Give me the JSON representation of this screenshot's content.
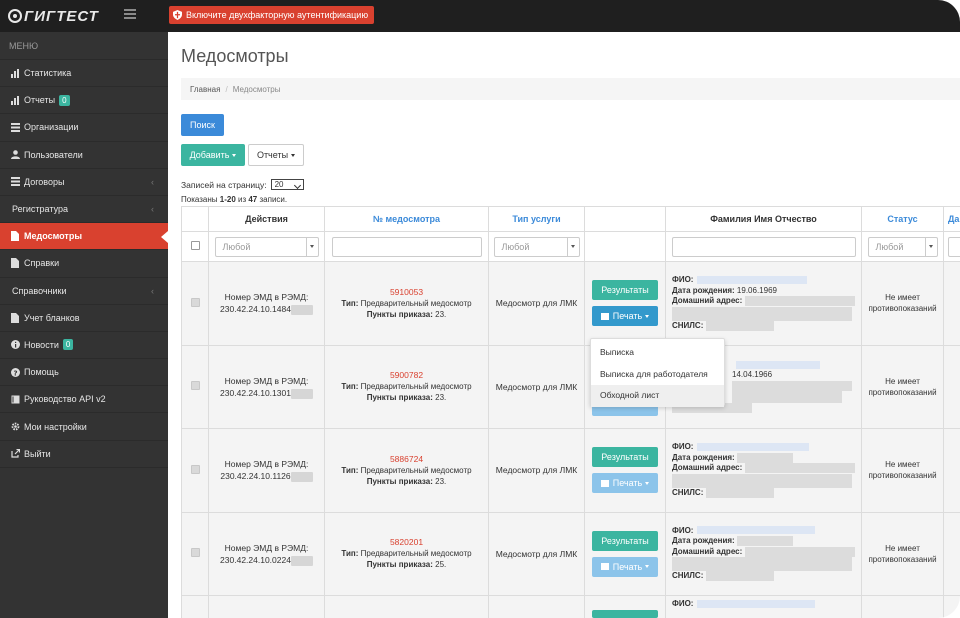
{
  "app": {
    "logo_text": "ГИГТЕСТ",
    "alert_2fa": "Включите двухфакторную аутентификацию"
  },
  "colors": {
    "sidebar_bg": "#333333",
    "topbar_bg": "#1f1f1f",
    "accent_red": "#d9412f",
    "teal": "#3bb5a0",
    "blue": "#3b8ad9"
  },
  "sidebar": {
    "header": "МЕНЮ",
    "items": [
      {
        "label": "Статистика",
        "icon": "bar-chart-icon"
      },
      {
        "label": "Отчеты",
        "icon": "bar-chart-icon",
        "badge": "0"
      },
      {
        "label": "Организации",
        "icon": "list-icon"
      },
      {
        "label": "Пользователи",
        "icon": "user-icon"
      },
      {
        "label": "Договоры",
        "icon": "list-icon",
        "chevron": "‹"
      },
      {
        "label": "Регистратура",
        "chevron": "‹"
      },
      {
        "label": "Медосмотры",
        "icon": "file-icon",
        "active": true
      },
      {
        "label": "Справки",
        "icon": "file-icon"
      },
      {
        "label": "Справочники",
        "chevron": "‹"
      },
      {
        "label": "Учет бланков",
        "icon": "file-icon"
      },
      {
        "label": "Новости",
        "icon": "info-icon",
        "badge": "0"
      },
      {
        "label": "Помощь",
        "icon": "question-icon"
      },
      {
        "label": "Руководство API v2",
        "icon": "book-icon"
      },
      {
        "label": "Мои настройки",
        "icon": "gear-icon"
      },
      {
        "label": "Выйти",
        "icon": "logout-icon"
      }
    ]
  },
  "page": {
    "title": "Медосмотры",
    "breadcrumb": {
      "home": "Главная",
      "sep": "/",
      "current": "Медосмотры"
    },
    "search_button": "Поиск",
    "add_button": "Добавить",
    "reports_button": "Отчеты",
    "per_page_label": "Записей на страницу:",
    "per_page_value": "20",
    "shown_prefix": "Показаны ",
    "shown_range": "1-20",
    "shown_mid": " из ",
    "shown_total": "47",
    "shown_suffix": " записи."
  },
  "table": {
    "headers": {
      "actions": "Действия",
      "number": "№ медосмотра",
      "service_type": "Тип услуги",
      "fio": "Фамилия Имя Отчество",
      "status": "Статус",
      "date_partial": "Да"
    },
    "filter_any": "Любой",
    "labels": {
      "emd": "Номер ЭМД в РЭМД:",
      "type": "Тип:",
      "points": "Пункты приказа:",
      "results_button": "Результаты",
      "print_button": "Печать",
      "fio": "ФИО:",
      "birth": "Дата рождения:",
      "address": "Домашний адрес:",
      "snils": "СНИЛС:"
    },
    "rows": [
      {
        "emd_number": "230.42.24.10.1484",
        "exam_number": "5910053",
        "type_value": "Предварительный медосмотр",
        "points_value": "23.",
        "service": "Медосмотр для ЛМК",
        "birth_date": "19.06.1969",
        "status": "Не имеет противопоказаний"
      },
      {
        "emd_number": "230.42.24.10.1301",
        "exam_number": "5900782",
        "type_value": "Предварительный медосмотр",
        "points_value": "23.",
        "service": "Медосмотр для ЛМК",
        "birth_date": "14.04.1966",
        "status": "Не имеет противопоказаний"
      },
      {
        "emd_number": "230.42.24.10.1126",
        "exam_number": "5886724",
        "type_value": "Предварительный медосмотр",
        "points_value": "23.",
        "service": "Медосмотр для ЛМК",
        "birth_date": "",
        "status": "Не имеет противопоказаний"
      },
      {
        "emd_number": "230.42.24.10.0224",
        "exam_number": "5820201",
        "type_value": "Предварительный медосмотр",
        "points_value": "25.",
        "service": "Медосмотр для ЛМК",
        "birth_date": "",
        "status": "Не имеет противопоказаний"
      }
    ]
  },
  "print_menu": {
    "items": [
      "Выписка",
      "Выписка для работодателя",
      "Обходной лист"
    ]
  }
}
